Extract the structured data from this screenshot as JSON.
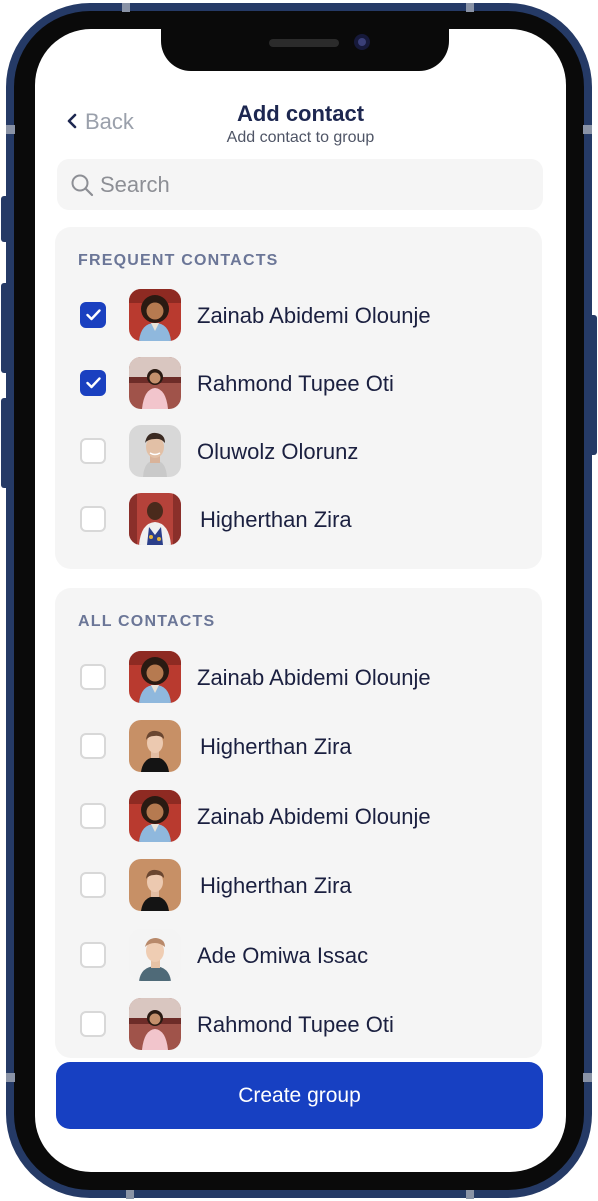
{
  "header": {
    "back_label": "Back",
    "title": "Add contact",
    "subtitle": "Add contact to group"
  },
  "search": {
    "placeholder": "Search",
    "value": ""
  },
  "frequent": {
    "heading": "FREQUENT CONTACTS",
    "items": [
      {
        "name": "Zainab Abidemi Olounje",
        "checked": true,
        "avatar": "avatar-woman-curly-hair"
      },
      {
        "name": "Rahmond Tupee Oti",
        "checked": true,
        "avatar": "avatar-woman-stadium"
      },
      {
        "name": "Oluwolz Olorunz",
        "checked": false,
        "avatar": "avatar-man-grey-background"
      },
      {
        "name": "Higherthan Zira",
        "checked": false,
        "avatar": "avatar-man-patterned-shirt"
      }
    ]
  },
  "all": {
    "heading": "ALL CONTACTS",
    "items": [
      {
        "name": "Zainab Abidemi Olounje",
        "checked": false,
        "avatar": "avatar-woman-curly-hair"
      },
      {
        "name": "Higherthan Zira",
        "checked": false,
        "avatar": "avatar-man-tan-background"
      },
      {
        "name": "Zainab Abidemi Olounje",
        "checked": false,
        "avatar": "avatar-woman-curly-hair"
      },
      {
        "name": "Higherthan Zira",
        "checked": false,
        "avatar": "avatar-man-tan-background"
      },
      {
        "name": "Ade Omiwa Issac",
        "checked": false,
        "avatar": "avatar-man-white-background"
      },
      {
        "name": "Rahmond Tupee Oti",
        "checked": false,
        "avatar": "avatar-woman-stadium"
      }
    ]
  },
  "cta": {
    "label": "Create group"
  },
  "colors": {
    "accent": "#1740c2",
    "frame": "#253a66",
    "title": "#1d2750",
    "section_heading": "#6b7697"
  }
}
